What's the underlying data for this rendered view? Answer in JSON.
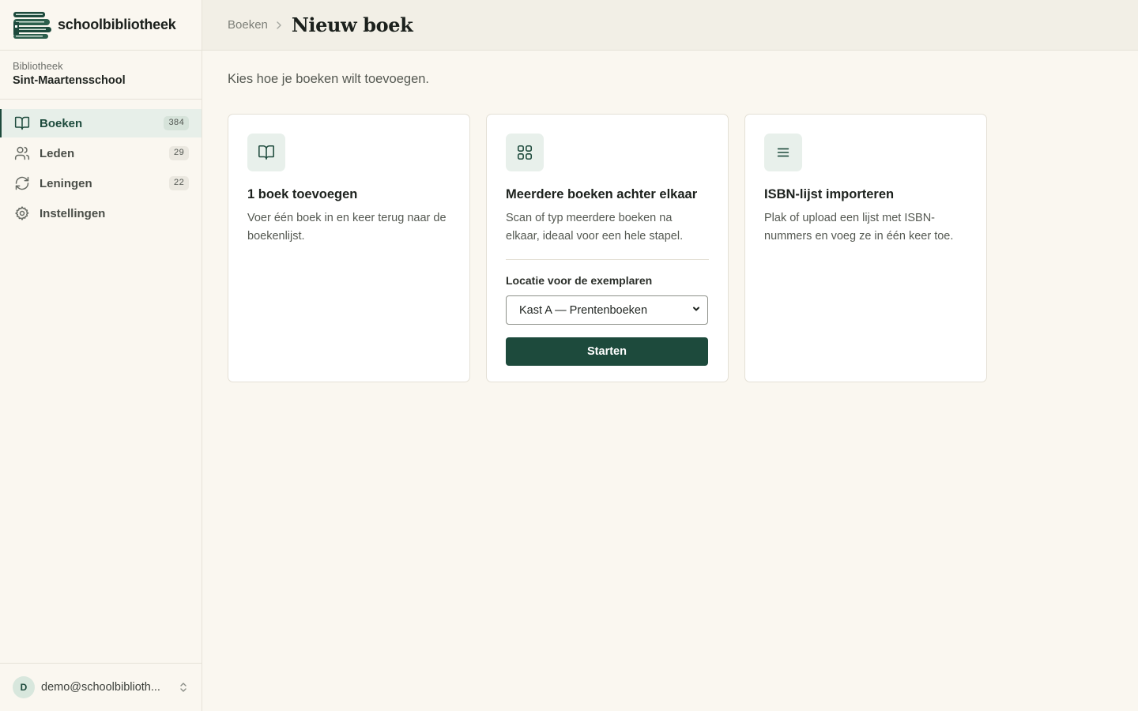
{
  "brand": {
    "name": "schoolbibliotheek",
    "logo": "stacked-books-b-logo"
  },
  "library": {
    "label": "Bibliotheek",
    "name": "Sint-Maartensschool"
  },
  "nav": [
    {
      "label": "Boeken",
      "count": "384",
      "icon": "book-open-icon",
      "active": true
    },
    {
      "label": "Leden",
      "count": "29",
      "icon": "users-icon",
      "active": false
    },
    {
      "label": "Leningen",
      "count": "22",
      "icon": "refresh-icon",
      "active": false
    },
    {
      "label": "Instellingen",
      "count": "",
      "icon": "gear-icon",
      "active": false
    }
  ],
  "user": {
    "initial": "D",
    "email": "demo@schoolbiblioth..."
  },
  "header": {
    "breadcrumb": "Boeken",
    "title": "Nieuw boek"
  },
  "main": {
    "intro": "Kies hoe je boeken wilt toevoegen.",
    "cards": [
      {
        "title": "1 boek toevoegen",
        "desc": "Voer één boek in en keer terug naar de boekenlijst.",
        "icon": "book-open-icon"
      },
      {
        "title": "Meerdere boeken achter elkaar",
        "desc": "Scan of typ meerdere boeken na elkaar, ideaal voor een hele stapel.",
        "icon": "grid-icon",
        "location_label": "Locatie voor de exemplaren",
        "location_value": "Kast A — Prentenboeken",
        "button": "Starten"
      },
      {
        "title": "ISBN-lijst importeren",
        "desc": "Plak of upload een lijst met ISBN-nummers en voeg ze in één keer toe.",
        "icon": "list-icon"
      }
    ]
  },
  "colors": {
    "accent": "#1d4a3c",
    "background": "#faf7f0",
    "header": "#f2efe6",
    "icon_tile": "#e8f0eb"
  }
}
